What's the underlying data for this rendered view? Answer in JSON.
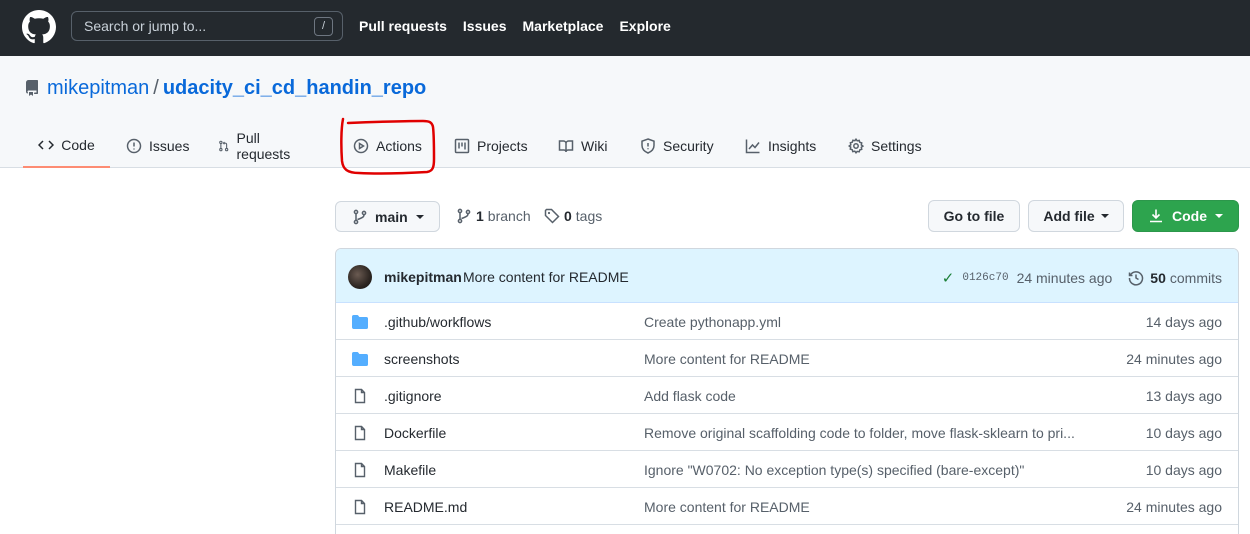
{
  "header": {
    "search_placeholder": "Search or jump to...",
    "search_shortcut": "/",
    "nav": [
      "Pull requests",
      "Issues",
      "Marketplace",
      "Explore"
    ]
  },
  "repo": {
    "owner": "mikepitman",
    "separator": "/",
    "name": "udacity_ci_cd_handin_repo"
  },
  "tabs": [
    {
      "label": "Code",
      "icon": "code-icon",
      "active": true
    },
    {
      "label": "Issues",
      "icon": "issue-icon",
      "active": false
    },
    {
      "label": "Pull requests",
      "icon": "pull-request-icon",
      "active": false
    },
    {
      "label": "Actions",
      "icon": "play-icon",
      "active": false
    },
    {
      "label": "Projects",
      "icon": "project-icon",
      "active": false
    },
    {
      "label": "Wiki",
      "icon": "book-icon",
      "active": false
    },
    {
      "label": "Security",
      "icon": "shield-icon",
      "active": false
    },
    {
      "label": "Insights",
      "icon": "graph-icon",
      "active": false
    },
    {
      "label": "Settings",
      "icon": "gear-icon",
      "active": false
    }
  ],
  "toolbar": {
    "branch": "main",
    "branch_count": "1",
    "branch_label": "branch",
    "tag_count": "0",
    "tag_label": "tags",
    "go_to_file": "Go to file",
    "add_file": "Add file",
    "code": "Code"
  },
  "latest_commit": {
    "author": "mikepitman",
    "message": "More content for README",
    "sha": "0126c70",
    "age": "24 minutes ago",
    "commit_count": "50",
    "commit_label": "commits"
  },
  "files": [
    {
      "type": "dir",
      "name": ".github/workflows",
      "message": "Create pythonapp.yml",
      "age": "14 days ago"
    },
    {
      "type": "dir",
      "name": "screenshots",
      "message": "More content for README",
      "age": "24 minutes ago"
    },
    {
      "type": "file",
      "name": ".gitignore",
      "message": "Add flask code",
      "age": "13 days ago"
    },
    {
      "type": "file",
      "name": "Dockerfile",
      "message": "Remove original scaffolding code to folder, move flask-sklearn to pri...",
      "age": "10 days ago"
    },
    {
      "type": "file",
      "name": "Makefile",
      "message": "Ignore \"W0702: No exception type(s) specified (bare-except)\"",
      "age": "10 days ago"
    },
    {
      "type": "file",
      "name": "README.md",
      "message": "More content for README",
      "age": "24 minutes ago"
    }
  ],
  "colors": {
    "header_bg": "#24292e",
    "link": "#0969da",
    "green_button": "#2da44e",
    "annotation_red": "#e00000",
    "tab_underline": "#fd8c73"
  }
}
